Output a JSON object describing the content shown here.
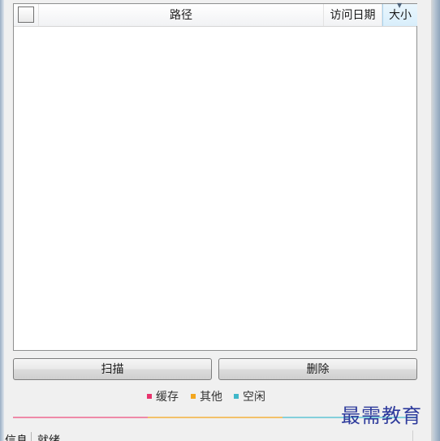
{
  "listview": {
    "columns": {
      "path": "路径",
      "access_date": "访问日期",
      "size": "大小"
    },
    "sorted_column": "size",
    "select_all_checked": false,
    "rows": []
  },
  "buttons": {
    "scan": "扫描",
    "delete": "删除"
  },
  "legend": [
    {
      "label": "缓存",
      "color": "#e8336d"
    },
    {
      "label": "其他",
      "color": "#f3a61e"
    },
    {
      "label": "空闲",
      "color": "#3fb7c9"
    }
  ],
  "usage_bar_colors": [
    "#ee8aa8",
    "#f3c16a",
    "#84cfdb"
  ],
  "status": {
    "label": "信息",
    "text": "就绪"
  },
  "watermark": "最需教育"
}
